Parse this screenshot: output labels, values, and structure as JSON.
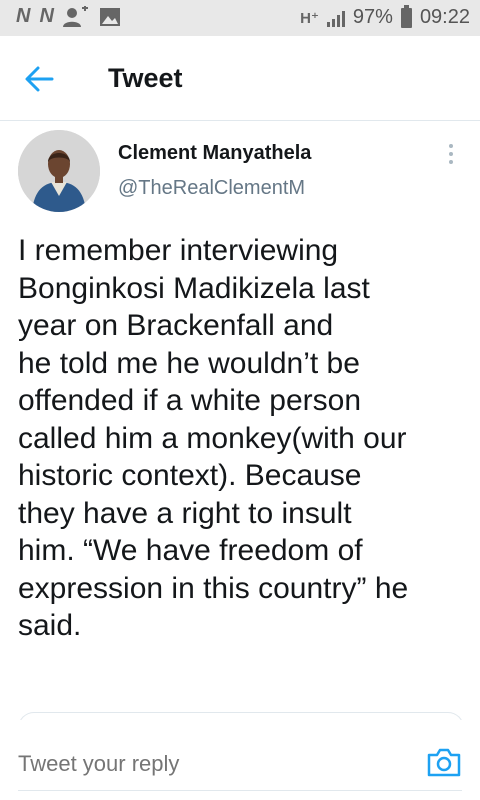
{
  "status_bar": {
    "notif_1": "N",
    "notif_2": "N",
    "network": "H⁺",
    "battery": "97%",
    "time": "09:22"
  },
  "header": {
    "title": "Tweet"
  },
  "tweet": {
    "author_name": "Clement Manyathela",
    "author_handle": "@TheRealClementM",
    "text_lines": [
      "I remember interviewing",
      "Bonginkosi Madikizela last",
      "year on Brackenfall and",
      "he told me he wouldn’t be",
      "offended if a white person",
      "called him a monkey(with our",
      "historic context). Because",
      "they have a right to insult",
      "him. “We have freedom of",
      "expression in this country” he",
      "said."
    ]
  },
  "reply": {
    "placeholder": "Tweet your reply"
  },
  "colors": {
    "accent": "#1da1f2",
    "text": "#14171a",
    "secondary_text": "#657786",
    "divider": "#e1e8ed",
    "status_bar_bg": "#e8e8e8"
  },
  "icons": {
    "back": "back-arrow-icon",
    "more": "more-vertical-icon",
    "camera": "camera-icon"
  }
}
